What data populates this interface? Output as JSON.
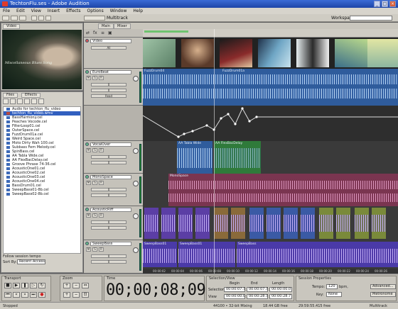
{
  "window": {
    "title": "TechtonFlu.ses - Adobe Audition"
  },
  "menu": [
    "File",
    "Edit",
    "View",
    "Insert",
    "Effects",
    "Options",
    "Window",
    "Help"
  ],
  "toolbar": {
    "multitrack_label": "Multitrack",
    "workspace_label": "Workspace:"
  },
  "video_panel": {
    "tab": "Video",
    "caption": "Miscellaneous Blues Song"
  },
  "files_panel": {
    "tabs": [
      "Files",
      "Effects"
    ],
    "items": [
      {
        "name": "Audio for techton_flu_video",
        "type": "audio"
      },
      {
        "name": "techton_flu_video.wmv",
        "type": "video"
      },
      {
        "name": "BassHarmony.cel",
        "type": "audio"
      },
      {
        "name": "Peaches Vocode.cel",
        "type": "audio"
      },
      {
        "name": "FilterLoop01.cel",
        "type": "audio"
      },
      {
        "name": "OuterSpace.cel",
        "type": "audio"
      },
      {
        "name": "FuzzDrum01a.cel",
        "type": "audio"
      },
      {
        "name": "Weird Space.cel",
        "type": "audio"
      },
      {
        "name": "Moto Dirty Wah 100.cel",
        "type": "audio"
      },
      {
        "name": "Subbass Fem Melody.cel",
        "type": "audio"
      },
      {
        "name": "SpinBass.cel",
        "type": "audio"
      },
      {
        "name": "AA Tabla Wide.cel",
        "type": "audio"
      },
      {
        "name": "AA FlexBacDelay.cel",
        "type": "audio"
      },
      {
        "name": "Groove Phrase 74-36.cel",
        "type": "audio"
      },
      {
        "name": "AcousticOne01.cel",
        "type": "audio"
      },
      {
        "name": "AcousticOne02.cel",
        "type": "audio"
      },
      {
        "name": "AcousticOne03.cel",
        "type": "audio"
      },
      {
        "name": "AcousticOne04.cel",
        "type": "audio"
      },
      {
        "name": "BassDrum01.cel",
        "type": "audio"
      },
      {
        "name": "SweepBass01-8b.cel",
        "type": "audio"
      },
      {
        "name": "SweepBass02-8b.cel",
        "type": "audio"
      }
    ],
    "follow_label": "Follow session tempo",
    "sort_label": "Sort By:",
    "sort_value": "Recent Access"
  },
  "main": {
    "tabs": [
      "Main",
      "Mixer"
    ],
    "video_track": {
      "name": "Video",
      "sub": "All"
    },
    "tracks": [
      {
        "name": "EuroBeat",
        "vol": "0",
        "pan": "0",
        "auto": "Read"
      },
      {
        "name": "VocalOver",
        "vol": "0",
        "pan": "0",
        "auto": "Read"
      },
      {
        "name": "MonoSpace",
        "vol": "0",
        "pan": "0",
        "auto": "Read"
      },
      {
        "name": "AcousticRiff",
        "vol": "0",
        "pan": "0",
        "auto": "Read"
      },
      {
        "name": "SweepBass",
        "vol": "0",
        "pan": "0",
        "auto": "Read"
      }
    ],
    "clips": {
      "eurobeat_a": "FuzzDrum04",
      "eurobeat_b": "FuzzDrum01a",
      "vocal_a": "AA Tabla Wide",
      "vocal_b": "AA FlexBacDelay",
      "mono": "MonoSpace",
      "sweep_a": "SweepBass01",
      "sweep_b": "SweepBass01",
      "sweep_c": "SweepBass"
    },
    "timeline": [
      "00:00:02",
      "00:00:04",
      "00:00:06",
      "00:00:08",
      "00:00:10",
      "00:00:12",
      "00:00:14",
      "00:00:16",
      "00:00:18",
      "00:00:20",
      "00:00:22",
      "00:00:24",
      "00:00:26"
    ]
  },
  "transport": {
    "title": "Transport",
    "zoom_title": "Zoom",
    "time_title": "Time",
    "time": "00;00;08;09"
  },
  "selection": {
    "title": "Selection/View",
    "cols": [
      "Begin",
      "End",
      "Length"
    ],
    "sel_label": "Selection",
    "view_label": "View",
    "sel_begin": "00:00:07.7",
    "sel_end": "00:00:07.7",
    "sel_len": "00:00:00.0",
    "view_begin": "00:00:00.0",
    "view_end": "00:00:28.7",
    "view_len": "00:00:28.7"
  },
  "session": {
    "title": "Session Properties",
    "tempo_label": "Tempo:",
    "tempo": "120",
    "bpm_label": "bpm,",
    "key_label": "Key:",
    "key": "None",
    "advanced": "Advanced...",
    "metronome": "Metronome"
  },
  "status": {
    "left": "Stopped",
    "mid": "44100 • 32-bit Mixing",
    "size": "18.44 GB free",
    "time_free": "29:59:55.415 free",
    "right": "Multitrack"
  }
}
